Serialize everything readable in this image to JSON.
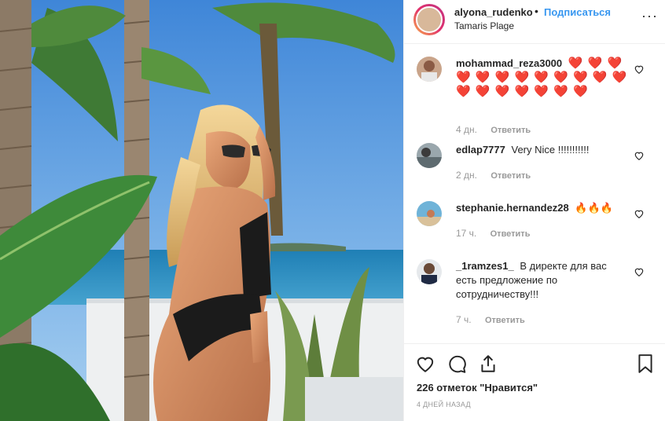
{
  "header": {
    "username": "alyona_rudenko",
    "separator": "•",
    "follow_label": "Подписаться",
    "location": "Tamaris Plage",
    "more_label": "···"
  },
  "comments": [
    {
      "username": "mohammad_reza3000",
      "text": "❤️ ❤️ ❤️ ❤️ ❤️ ❤️ ❤️ ❤️ ❤️ ❤️ ❤️ ❤️ ❤️ ❤️ ❤️ ❤️ ❤️ ❤️ ❤️",
      "time": "4 дн.",
      "reply_label": "Ответить"
    },
    {
      "username": "edlap7777",
      "text": "Very Nice !!!!!!!!!!!",
      "time": "2 дн.",
      "reply_label": "Ответить"
    },
    {
      "username": "stephanie.hernandez28",
      "text": "🔥🔥🔥",
      "time": "17 ч.",
      "reply_label": "Ответить"
    },
    {
      "username": "_1ramzes1_",
      "text": "В директе для вас есть предложение по сотрудничеству!!!",
      "time": "7 ч.",
      "reply_label": "Ответить"
    }
  ],
  "actions": {
    "likes_text": "226 отметок \"Нравится\"",
    "date_text": "4 ДНЕЙ НАЗАД"
  },
  "icons": [
    "heart-icon",
    "comment-icon",
    "share-icon",
    "bookmark-icon",
    "more-icon"
  ],
  "colors": {
    "link": "#3897f0",
    "muted": "#999999",
    "text": "#262626",
    "heart": "#ed2939"
  }
}
